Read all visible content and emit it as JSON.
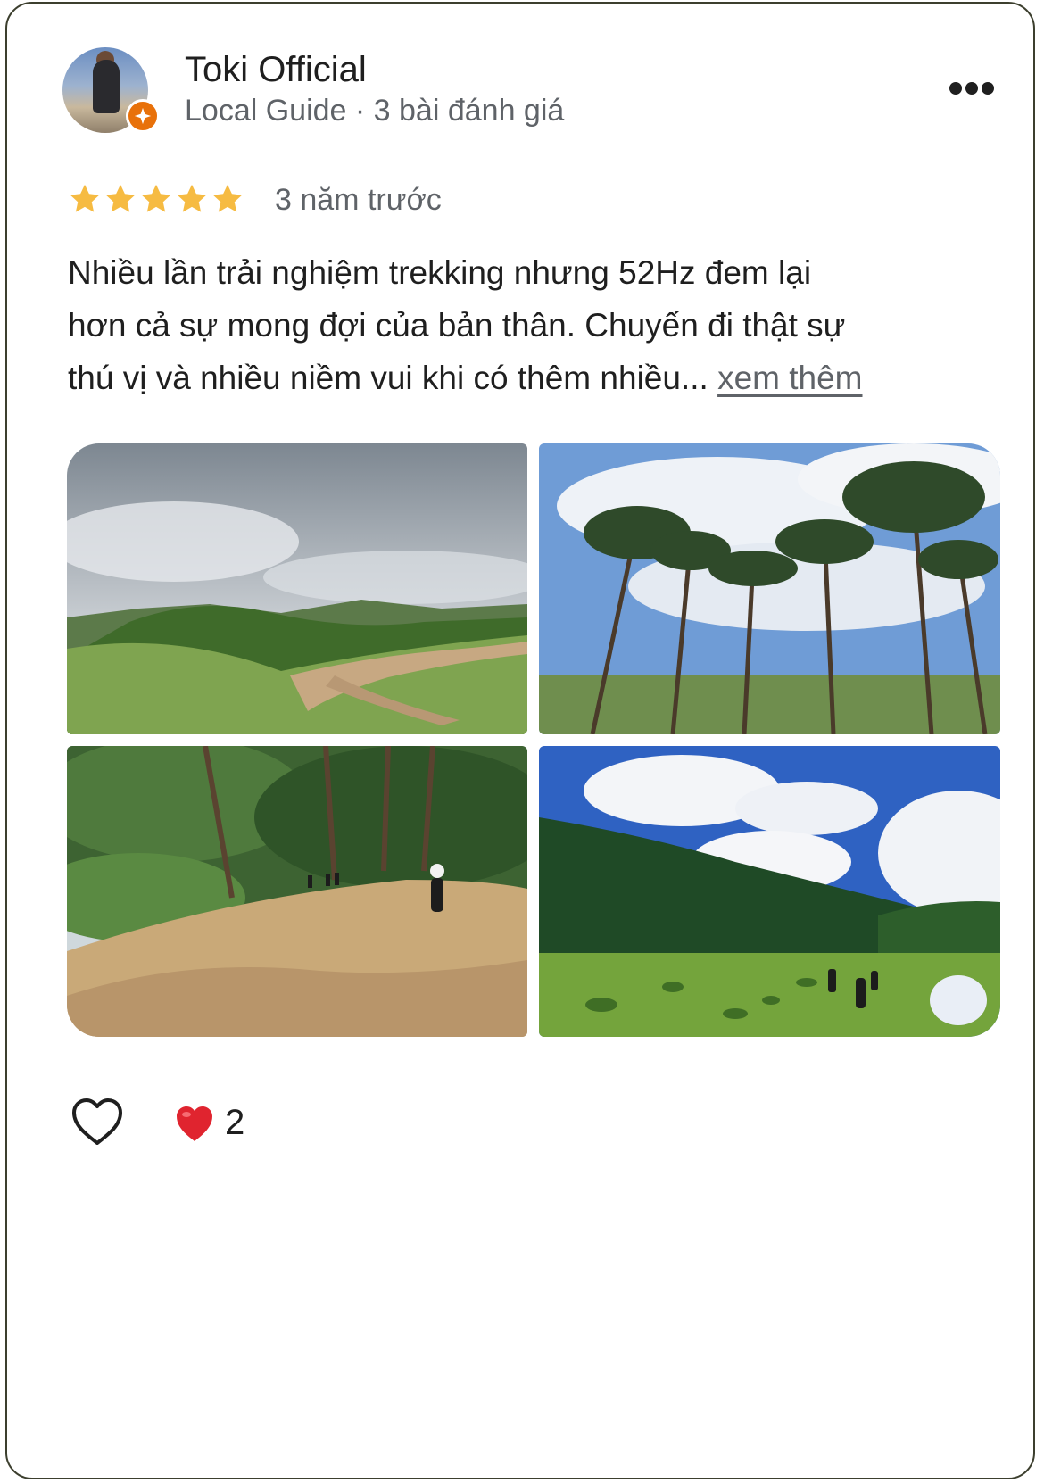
{
  "review": {
    "author_name": "Toki Official",
    "author_meta": "Local Guide · 3 bài đánh giá",
    "rating": 5,
    "time_ago": "3 năm trước",
    "text_lines": [
      "Nhiều lần trải nghiệm trekking nhưng 52Hz đem lại",
      "hơn cả sự mong đợi của bản thân. Chuyến đi thật sự",
      "thú vị và nhiều niềm vui khi có thêm nhiều... "
    ],
    "more_label": "xem thêm",
    "photos": [
      {
        "icon": "mountain-trail-photo"
      },
      {
        "icon": "pine-trees-photo"
      },
      {
        "icon": "forest-path-photo"
      },
      {
        "icon": "meadow-hikers-photo"
      }
    ],
    "reaction_count": "2"
  },
  "colors": {
    "star": "#f6bb42",
    "badge": "#e8710a",
    "heart": "#e0242f",
    "muted_text": "#5f6368"
  }
}
